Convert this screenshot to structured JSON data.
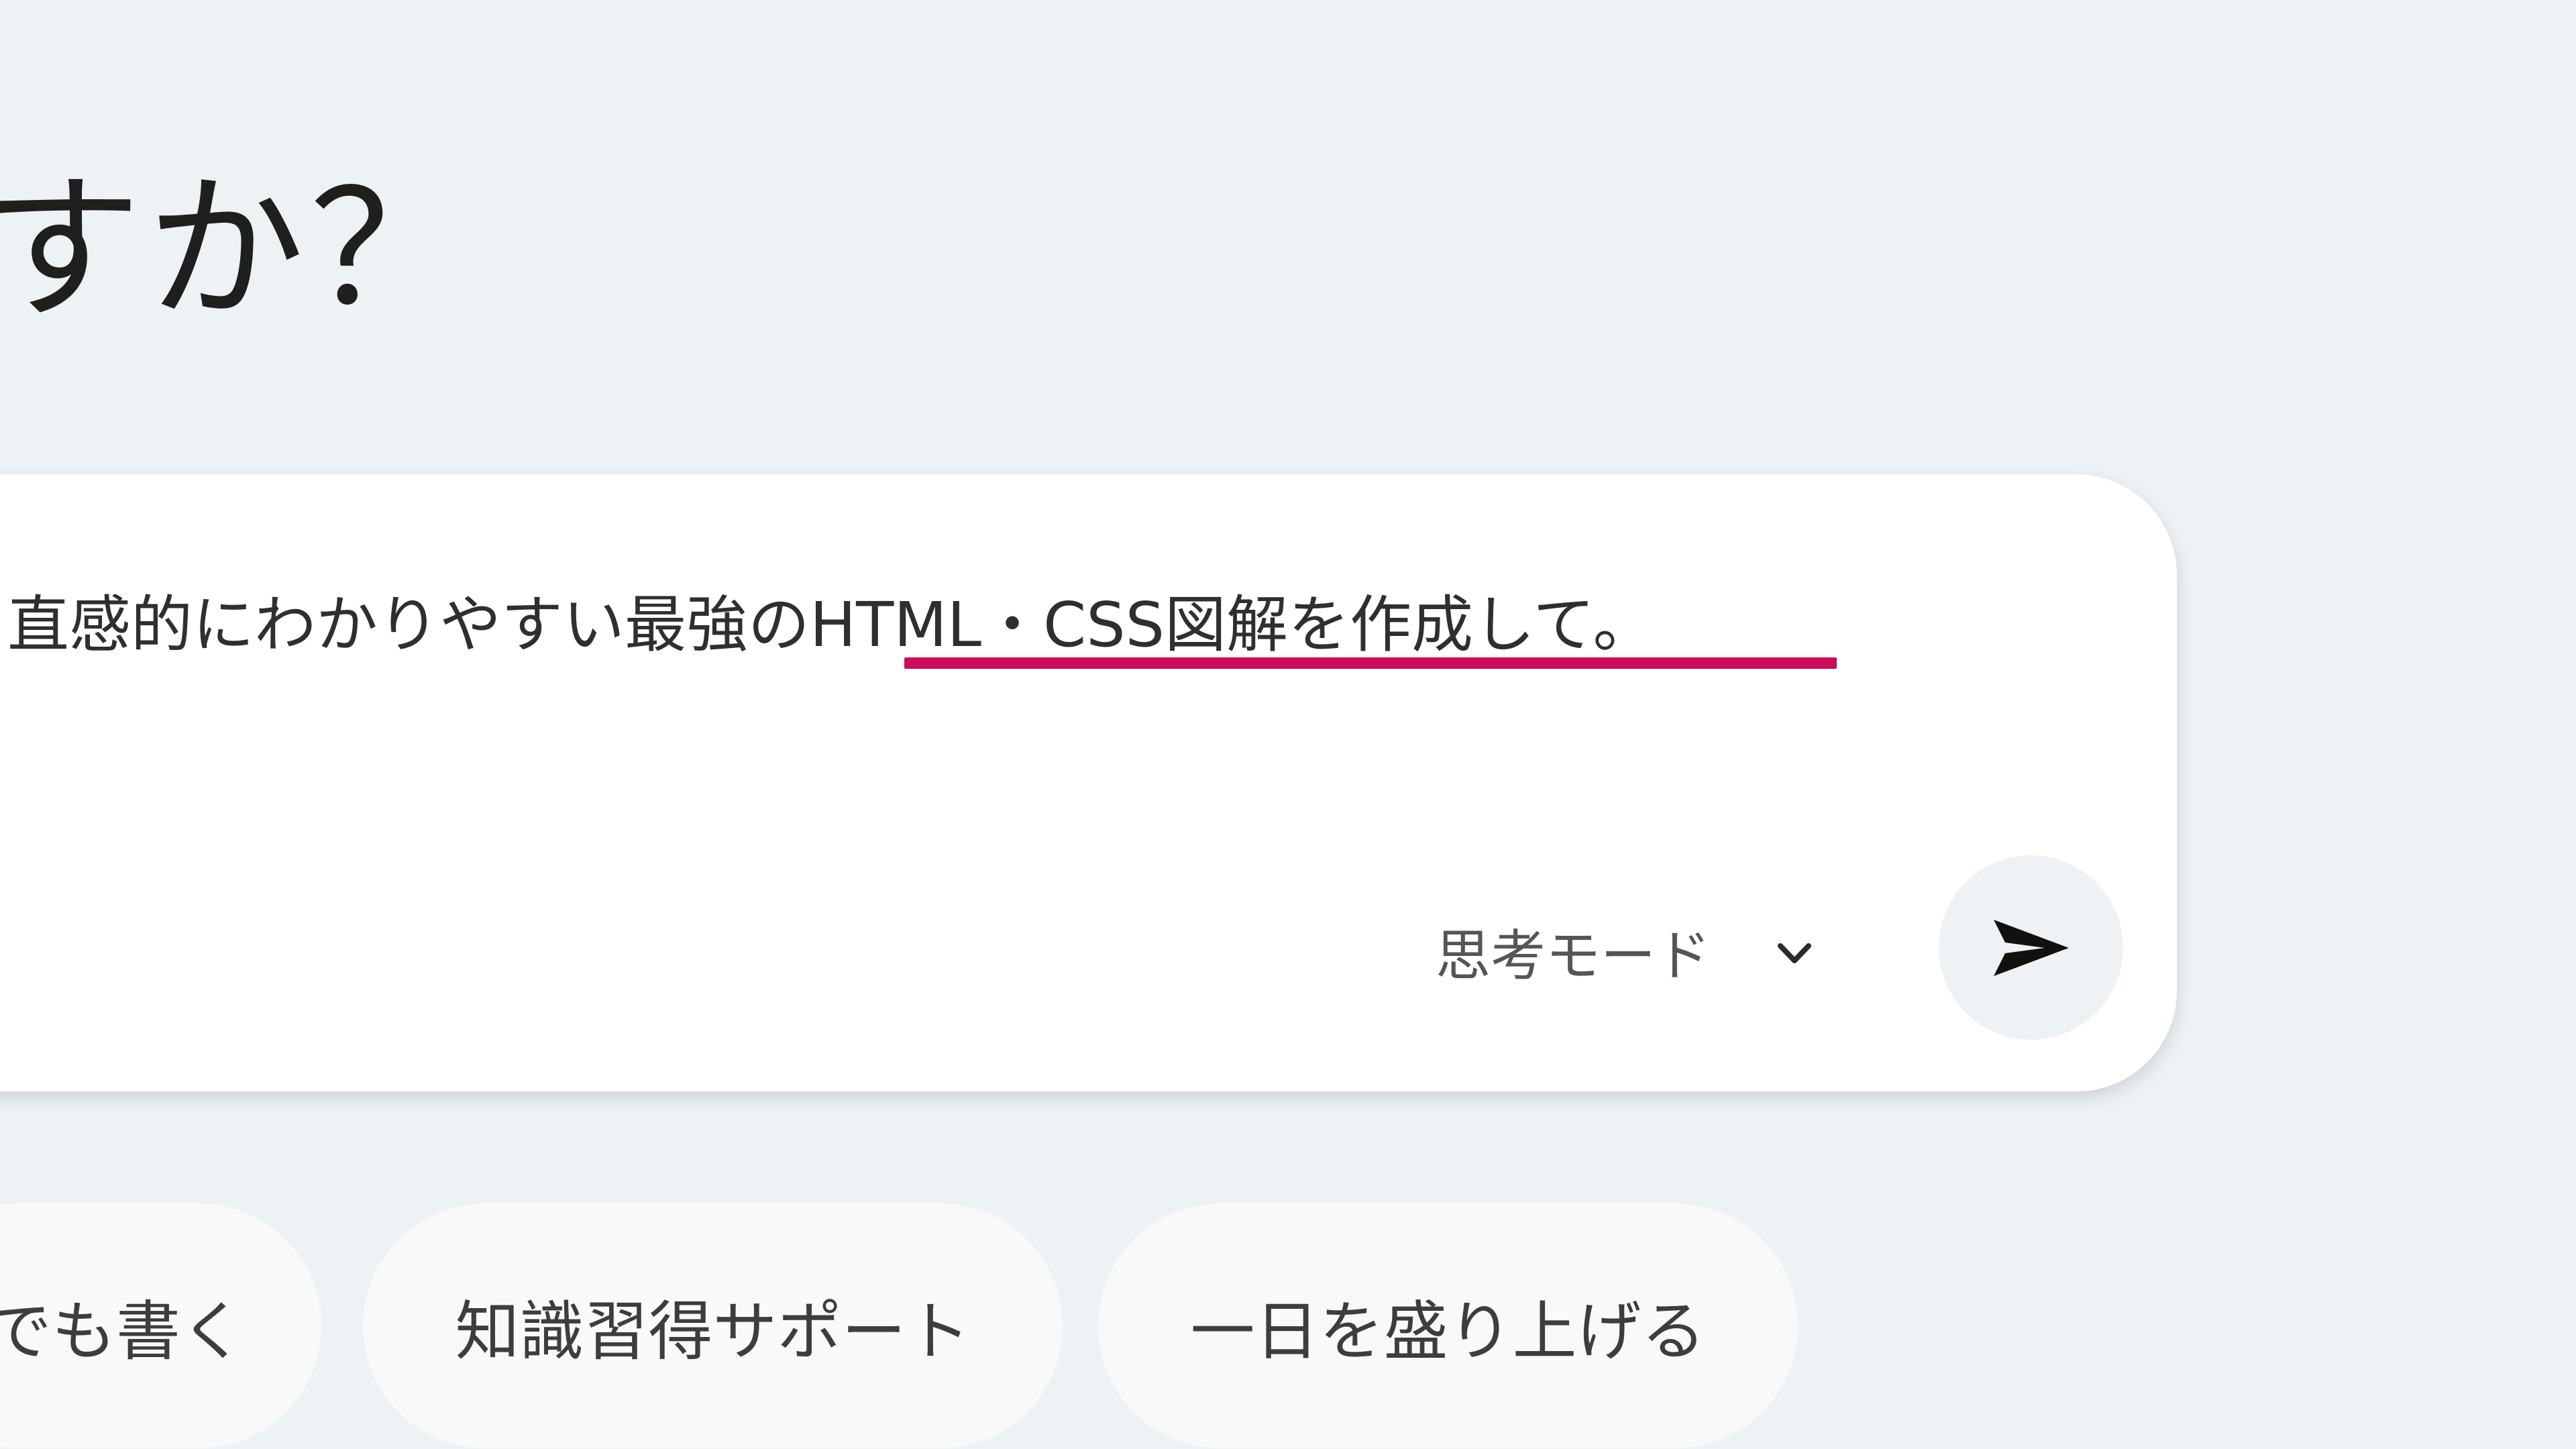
{
  "heading": {
    "visible_text": "すか？"
  },
  "composer": {
    "prompt_value": "直感的にわかりやすい最強のHTML・CSS図解を作成して。",
    "mode_label": "思考モード",
    "send_icon": "send-arrow-icon",
    "mode_icon": "chevron-down-icon",
    "highlight_color": "#cc0b5b"
  },
  "suggestions": [
    {
      "label": "でも書く"
    },
    {
      "label": "知識習得サポート"
    },
    {
      "label": "一日を盛り上げる"
    }
  ]
}
